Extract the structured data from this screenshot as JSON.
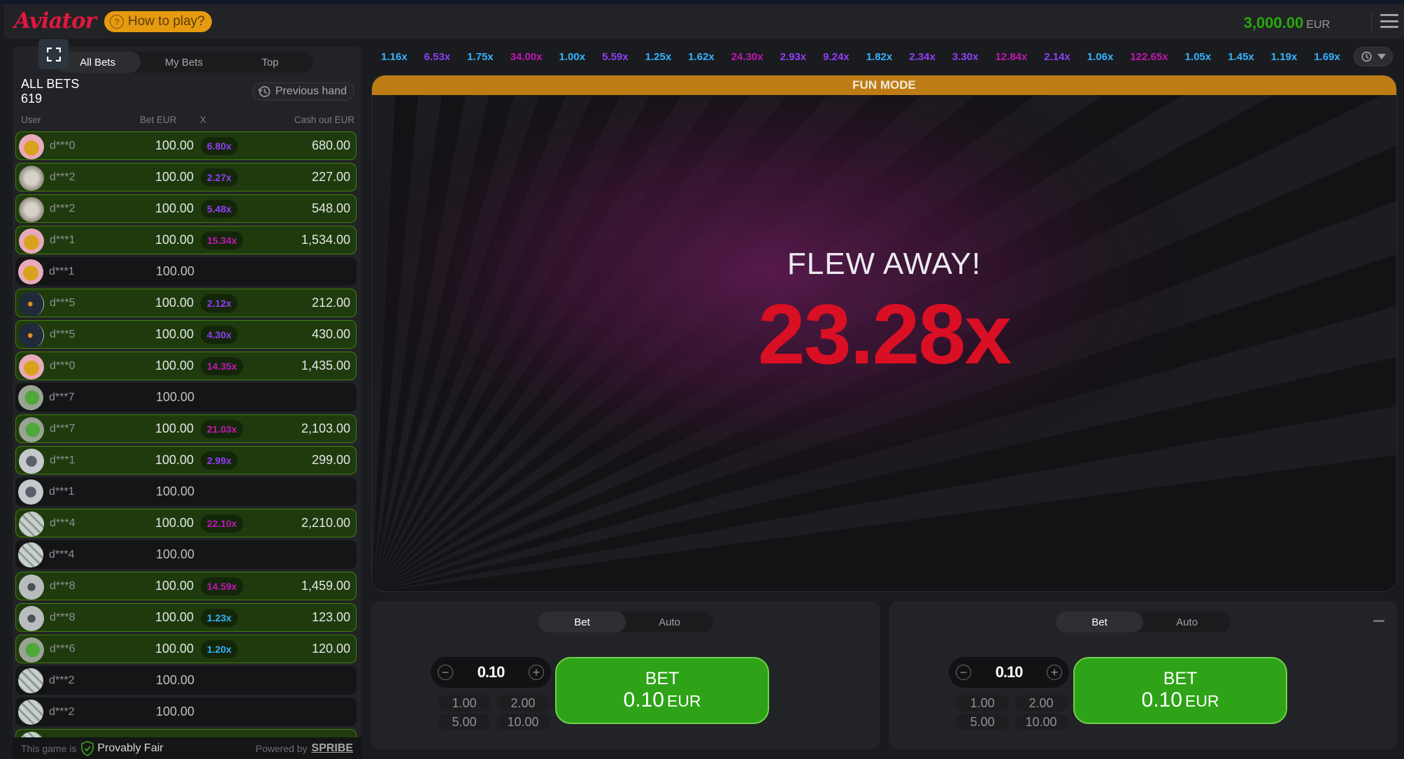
{
  "header": {
    "logo": "Aviator",
    "how_to_play": "How to play?",
    "balance": "3,000.00",
    "currency": "EUR"
  },
  "left_panel": {
    "tabs": [
      {
        "label": "All Bets",
        "active": true
      },
      {
        "label": "My Bets",
        "active": false
      },
      {
        "label": "Top",
        "active": false
      }
    ],
    "title": "ALL BETS",
    "count": "619",
    "previous_hand": "Previous hand",
    "columns": {
      "user": "User",
      "bet": "Bet EUR",
      "x": "X",
      "cashout": "Cash out EUR"
    },
    "rows": [
      {
        "user": "d***0",
        "bet": "100.00",
        "mult": "6.80x",
        "cashout": "680.00",
        "win": true,
        "avatar": "lucky-cat",
        "tier": "purple"
      },
      {
        "user": "d***2",
        "bet": "100.00",
        "mult": "2.27x",
        "cashout": "227.00",
        "win": true,
        "avatar": "thumbs-up",
        "tier": "purple"
      },
      {
        "user": "d***2",
        "bet": "100.00",
        "mult": "5.48x",
        "cashout": "548.00",
        "win": true,
        "avatar": "thumbs-up",
        "tier": "purple"
      },
      {
        "user": "d***1",
        "bet": "100.00",
        "mult": "15.34x",
        "cashout": "1,534.00",
        "win": true,
        "avatar": "lucky-cat",
        "tier": "pink"
      },
      {
        "user": "d***1",
        "bet": "100.00",
        "mult": "",
        "cashout": "",
        "win": false,
        "avatar": "lucky-cat",
        "tier": ""
      },
      {
        "user": "d***5",
        "bet": "100.00",
        "mult": "2.12x",
        "cashout": "212.00",
        "win": true,
        "avatar": "moon",
        "tier": "purple"
      },
      {
        "user": "d***5",
        "bet": "100.00",
        "mult": "4.30x",
        "cashout": "430.00",
        "win": true,
        "avatar": "moon",
        "tier": "purple"
      },
      {
        "user": "d***0",
        "bet": "100.00",
        "mult": "14.35x",
        "cashout": "1,435.00",
        "win": true,
        "avatar": "lucky-cat",
        "tier": "pink"
      },
      {
        "user": "d***7",
        "bet": "100.00",
        "mult": "",
        "cashout": "",
        "win": false,
        "avatar": "clover",
        "tier": ""
      },
      {
        "user": "d***7",
        "bet": "100.00",
        "mult": "21.03x",
        "cashout": "2,103.00",
        "win": true,
        "avatar": "clover",
        "tier": "pink"
      },
      {
        "user": "d***1",
        "bet": "100.00",
        "mult": "2.99x",
        "cashout": "299.00",
        "win": true,
        "avatar": "jet",
        "tier": "purple"
      },
      {
        "user": "d***1",
        "bet": "100.00",
        "mult": "",
        "cashout": "",
        "win": false,
        "avatar": "jet",
        "tier": ""
      },
      {
        "user": "d***4",
        "bet": "100.00",
        "mult": "22.10x",
        "cashout": "2,210.00",
        "win": true,
        "avatar": "dollar",
        "tier": "pink"
      },
      {
        "user": "d***4",
        "bet": "100.00",
        "mult": "",
        "cashout": "",
        "win": false,
        "avatar": "dollar",
        "tier": ""
      },
      {
        "user": "d***8",
        "bet": "100.00",
        "mult": "14.59x",
        "cashout": "1,459.00",
        "win": true,
        "avatar": "plane",
        "tier": "pink"
      },
      {
        "user": "d***8",
        "bet": "100.00",
        "mult": "1.23x",
        "cashout": "123.00",
        "win": true,
        "avatar": "plane",
        "tier": "blue"
      },
      {
        "user": "d***6",
        "bet": "100.00",
        "mult": "1.20x",
        "cashout": "120.00",
        "win": true,
        "avatar": "clover",
        "tier": "blue"
      },
      {
        "user": "d***2",
        "bet": "100.00",
        "mult": "",
        "cashout": "",
        "win": false,
        "avatar": "dollar",
        "tier": ""
      },
      {
        "user": "d***2",
        "bet": "100.00",
        "mult": "",
        "cashout": "",
        "win": false,
        "avatar": "dollar",
        "tier": ""
      },
      {
        "user": "",
        "bet": "",
        "mult": "",
        "cashout": "",
        "win": true,
        "avatar": "dollar",
        "tier": ""
      }
    ],
    "footer": {
      "prefix": "This game is",
      "provably_fair": "Provably Fair",
      "powered_by": "Powered by",
      "brand": "SPRIBE"
    }
  },
  "history": [
    {
      "value": "1.16x",
      "tier": "blue"
    },
    {
      "value": "6.53x",
      "tier": "purple"
    },
    {
      "value": "1.75x",
      "tier": "blue"
    },
    {
      "value": "34.00x",
      "tier": "pink"
    },
    {
      "value": "1.00x",
      "tier": "blue"
    },
    {
      "value": "5.59x",
      "tier": "purple"
    },
    {
      "value": "1.25x",
      "tier": "blue"
    },
    {
      "value": "1.62x",
      "tier": "blue"
    },
    {
      "value": "24.30x",
      "tier": "pink"
    },
    {
      "value": "2.93x",
      "tier": "purple"
    },
    {
      "value": "9.24x",
      "tier": "purple"
    },
    {
      "value": "1.82x",
      "tier": "blue"
    },
    {
      "value": "2.34x",
      "tier": "purple"
    },
    {
      "value": "3.30x",
      "tier": "purple"
    },
    {
      "value": "12.84x",
      "tier": "pink"
    },
    {
      "value": "2.14x",
      "tier": "purple"
    },
    {
      "value": "1.06x",
      "tier": "blue"
    },
    {
      "value": "122.65x",
      "tier": "pink"
    },
    {
      "value": "1.05x",
      "tier": "blue"
    },
    {
      "value": "1.45x",
      "tier": "blue"
    },
    {
      "value": "1.19x",
      "tier": "blue"
    },
    {
      "value": "1.69x",
      "tier": "blue"
    }
  ],
  "game": {
    "mode_banner": "FUN MODE",
    "status": "FLEW AWAY!",
    "multiplier": "23.28x"
  },
  "bet_panels": [
    {
      "tabs": [
        {
          "label": "Bet",
          "active": true
        },
        {
          "label": "Auto",
          "active": false
        }
      ],
      "amount": "0.10",
      "quick_amounts": [
        "1.00",
        "2.00",
        "5.00",
        "10.00"
      ],
      "button_line1": "BET",
      "button_amount": "0.10",
      "button_currency": "EUR"
    },
    {
      "tabs": [
        {
          "label": "Bet",
          "active": true
        },
        {
          "label": "Auto",
          "active": false
        }
      ],
      "amount": "0.10",
      "quick_amounts": [
        "1.00",
        "2.00",
        "5.00",
        "10.00"
      ],
      "button_line1": "BET",
      "button_amount": "0.10",
      "button_currency": "EUR"
    }
  ],
  "colors": {
    "tier_blue": "#34b4ff",
    "tier_purple": "#913ef8",
    "tier_pink": "#c017b4",
    "brand_red": "#e0173f",
    "bet_green": "#2ea317",
    "balance_green": "#28a909",
    "fun_mode": "#bd7c14"
  }
}
